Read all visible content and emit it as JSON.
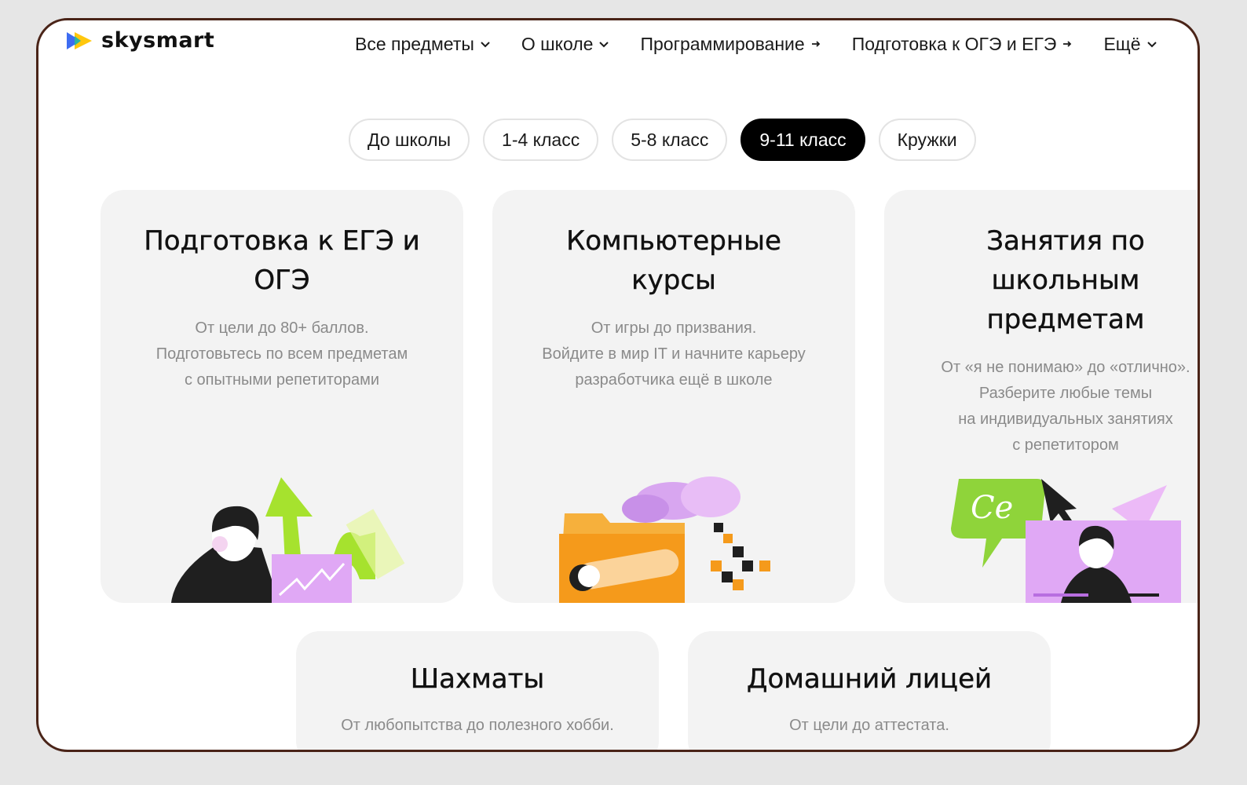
{
  "brand": {
    "name": "skysmart"
  },
  "nav": [
    {
      "label": "Все предметы",
      "icon": "chevron-down-icon"
    },
    {
      "label": "О школе",
      "icon": "chevron-down-icon"
    },
    {
      "label": "Программирование",
      "icon": "arrow-right-icon"
    },
    {
      "label": "Подготовка к ОГЭ и ЕГЭ",
      "icon": "arrow-right-icon"
    },
    {
      "label": "Ещё",
      "icon": "chevron-down-icon"
    }
  ],
  "tabs": [
    {
      "label": "До школы",
      "active": false
    },
    {
      "label": "1-4 класс",
      "active": false
    },
    {
      "label": "5-8 класс",
      "active": false
    },
    {
      "label": "9-11 класс",
      "active": true
    },
    {
      "label": "Кружки",
      "active": false
    }
  ],
  "cards": [
    {
      "title": "Подготовка к ЕГЭ и ОГЭ",
      "lines": [
        "От цели до 80+ баллов.",
        "Подготовьтесь по всем предметам",
        "с опытными репетиторами"
      ]
    },
    {
      "title": "Компьютерные курсы",
      "lines": [
        "От игры до призвания.",
        "Войдите в мир IT и начните карьеру",
        "разработчика ещё в школе"
      ]
    },
    {
      "title": "Занятия по школьным предметам",
      "lines": [
        "От «я не понимаю» до «отлично».",
        "Разберите любые темы",
        "на индивидуальных занятиях",
        "с репетитором"
      ]
    },
    {
      "title": "Шахматы",
      "lines": [
        "От любопытства до полезного хобби."
      ]
    },
    {
      "title": "Домашний лицей",
      "lines": [
        "От цели до аттестата."
      ]
    }
  ],
  "colors": {
    "frame_border": "#4a2418",
    "card_bg": "#f3f3f3",
    "active_tab": "#000000",
    "accent_green": "#a6e22e",
    "accent_purple": "#e0a8f5",
    "accent_orange": "#f6a623",
    "logo_blue": "#3d6cf2",
    "logo_yellow": "#ffc400"
  }
}
